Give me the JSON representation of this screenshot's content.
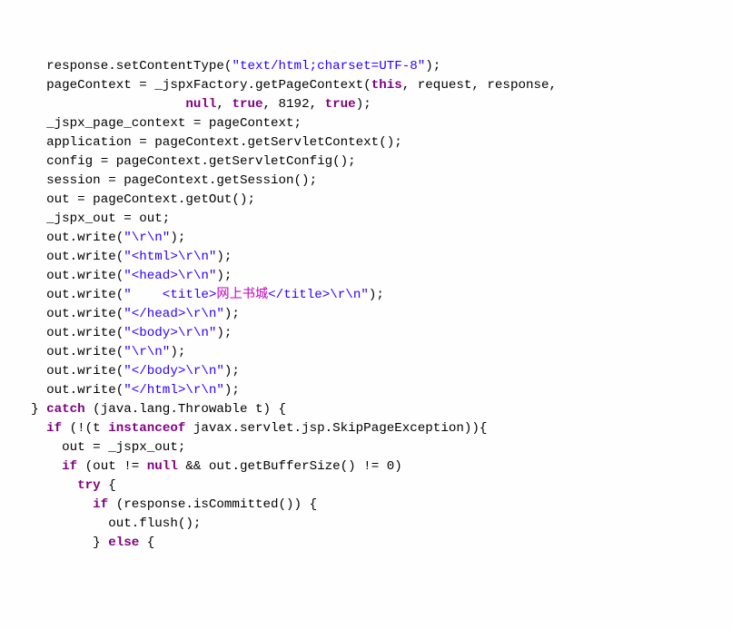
{
  "lines": [
    {
      "indent": "      ",
      "tokens": [
        {
          "t": "response.setContentType(",
          "c": "n"
        },
        {
          "t": "\"text/html;charset=UTF-8\"",
          "c": "s"
        },
        {
          "t": ");",
          "c": "n"
        }
      ]
    },
    {
      "indent": "      ",
      "tokens": [
        {
          "t": "pageContext = _jspxFactory.getPageContext(",
          "c": "n"
        },
        {
          "t": "this",
          "c": "k"
        },
        {
          "t": ", request, response,",
          "c": "n"
        }
      ]
    },
    {
      "indent": "      \t\t\t",
      "tokens": [
        {
          "t": "null",
          "c": "k"
        },
        {
          "t": ", ",
          "c": "n"
        },
        {
          "t": "true",
          "c": "k"
        },
        {
          "t": ", 8192, ",
          "c": "n"
        },
        {
          "t": "true",
          "c": "k"
        },
        {
          "t": ");",
          "c": "n"
        }
      ]
    },
    {
      "indent": "      ",
      "tokens": [
        {
          "t": "_jspx_page_context = pageContext;",
          "c": "n"
        }
      ]
    },
    {
      "indent": "      ",
      "tokens": [
        {
          "t": "application = pageContext.getServletContext();",
          "c": "n"
        }
      ]
    },
    {
      "indent": "      ",
      "tokens": [
        {
          "t": "config = pageContext.getServletConfig();",
          "c": "n"
        }
      ]
    },
    {
      "indent": "      ",
      "tokens": [
        {
          "t": "session = pageContext.getSession();",
          "c": "n"
        }
      ]
    },
    {
      "indent": "      ",
      "tokens": [
        {
          "t": "out = pageContext.getOut();",
          "c": "n"
        }
      ]
    },
    {
      "indent": "      ",
      "tokens": [
        {
          "t": "_jspx_out = out;",
          "c": "n"
        }
      ]
    },
    {
      "indent": "",
      "tokens": [
        {
          "t": "",
          "c": "n"
        }
      ]
    },
    {
      "indent": "      ",
      "tokens": [
        {
          "t": "out.write(",
          "c": "n"
        },
        {
          "t": "\"\\r\\n\"",
          "c": "s"
        },
        {
          "t": ");",
          "c": "n"
        }
      ]
    },
    {
      "indent": "      ",
      "tokens": [
        {
          "t": "out.write(",
          "c": "n"
        },
        {
          "t": "\"<html>\\r\\n\"",
          "c": "s"
        },
        {
          "t": ");",
          "c": "n"
        }
      ]
    },
    {
      "indent": "      ",
      "tokens": [
        {
          "t": "out.write(",
          "c": "n"
        },
        {
          "t": "\"<head>\\r\\n\"",
          "c": "s"
        },
        {
          "t": ");",
          "c": "n"
        }
      ]
    },
    {
      "indent": "      ",
      "tokens": [
        {
          "t": "out.write(",
          "c": "n"
        },
        {
          "t": "\"    <title>",
          "c": "s"
        },
        {
          "t": "网上书城",
          "c": "sp"
        },
        {
          "t": "</title>\\r\\n\"",
          "c": "s"
        },
        {
          "t": ");",
          "c": "n"
        }
      ]
    },
    {
      "indent": "      ",
      "tokens": [
        {
          "t": "out.write(",
          "c": "n"
        },
        {
          "t": "\"</head>\\r\\n\"",
          "c": "s"
        },
        {
          "t": ");",
          "c": "n"
        }
      ]
    },
    {
      "indent": "      ",
      "tokens": [
        {
          "t": "out.write(",
          "c": "n"
        },
        {
          "t": "\"<body>\\r\\n\"",
          "c": "s"
        },
        {
          "t": ");",
          "c": "n"
        }
      ]
    },
    {
      "indent": "      ",
      "tokens": [
        {
          "t": "out.write(",
          "c": "n"
        },
        {
          "t": "\"\\r\\n\"",
          "c": "s"
        },
        {
          "t": ");",
          "c": "n"
        }
      ]
    },
    {
      "indent": "      ",
      "tokens": [
        {
          "t": "out.write(",
          "c": "n"
        },
        {
          "t": "\"</body>\\r\\n\"",
          "c": "s"
        },
        {
          "t": ");",
          "c": "n"
        }
      ]
    },
    {
      "indent": "      ",
      "tokens": [
        {
          "t": "out.write(",
          "c": "n"
        },
        {
          "t": "\"</html>\\r\\n\"",
          "c": "s"
        },
        {
          "t": ");",
          "c": "n"
        }
      ]
    },
    {
      "indent": "    ",
      "tokens": [
        {
          "t": "} ",
          "c": "n"
        },
        {
          "t": "catch",
          "c": "k"
        },
        {
          "t": " (java.lang.Throwable t) {",
          "c": "n"
        }
      ]
    },
    {
      "indent": "      ",
      "tokens": [
        {
          "t": "if",
          "c": "k"
        },
        {
          "t": " (!(t ",
          "c": "n"
        },
        {
          "t": "instanceof",
          "c": "k"
        },
        {
          "t": " javax.servlet.jsp.SkipPageException)){",
          "c": "n"
        }
      ]
    },
    {
      "indent": "        ",
      "tokens": [
        {
          "t": "out = _jspx_out;",
          "c": "n"
        }
      ]
    },
    {
      "indent": "        ",
      "tokens": [
        {
          "t": "if",
          "c": "k"
        },
        {
          "t": " (out != ",
          "c": "n"
        },
        {
          "t": "null",
          "c": "k"
        },
        {
          "t": " && out.getBufferSize() != 0)",
          "c": "n"
        }
      ]
    },
    {
      "indent": "          ",
      "tokens": [
        {
          "t": "try",
          "c": "k"
        },
        {
          "t": " {",
          "c": "n"
        }
      ]
    },
    {
      "indent": "            ",
      "tokens": [
        {
          "t": "if",
          "c": "k"
        },
        {
          "t": " (response.isCommitted()) {",
          "c": "n"
        }
      ]
    },
    {
      "indent": "              ",
      "tokens": [
        {
          "t": "out.flush();",
          "c": "n"
        }
      ]
    },
    {
      "indent": "            ",
      "tokens": [
        {
          "t": "} ",
          "c": "n"
        },
        {
          "t": "else",
          "c": "k"
        },
        {
          "t": " {",
          "c": "n"
        }
      ]
    }
  ]
}
